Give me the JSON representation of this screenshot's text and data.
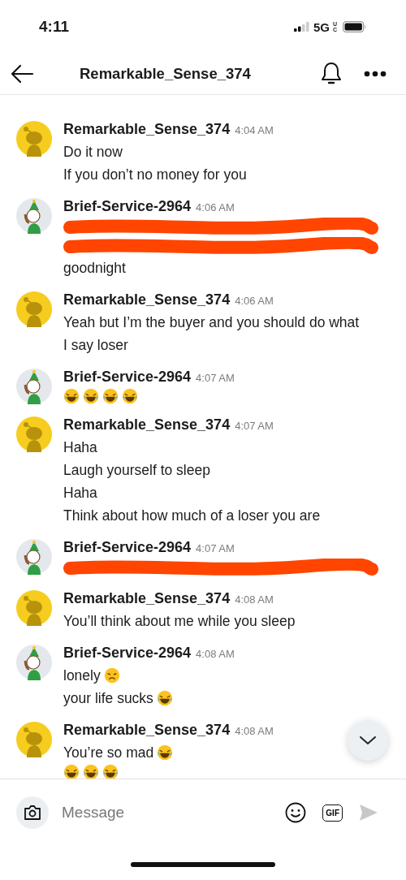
{
  "status_bar": {
    "time": "4:11",
    "network": "5G",
    "network_sub": "UC"
  },
  "header": {
    "title": "Remarkable_Sense_374"
  },
  "messages": [
    {
      "author": "Remarkable_Sense_374",
      "time": "4:04 AM",
      "avatar": {
        "kind": "yellow"
      },
      "lines": [
        {
          "kind": "text",
          "text": "Do it now"
        },
        {
          "kind": "text",
          "text": "If you don’t no money for you"
        }
      ]
    },
    {
      "author": "Brief-Service-2964",
      "time": "4:06 AM",
      "avatar": {
        "kind": "holiday"
      },
      "lines": [
        {
          "kind": "redacted"
        },
        {
          "kind": "redacted"
        },
        {
          "kind": "text",
          "text": "goodnight"
        }
      ]
    },
    {
      "author": "Remarkable_Sense_374",
      "time": "4:06 AM",
      "avatar": {
        "kind": "yellow"
      },
      "lines": [
        {
          "kind": "text",
          "text": "Yeah but I’m the buyer and you should do what I say loser"
        }
      ]
    },
    {
      "author": "Brief-Service-2964",
      "time": "4:07 AM",
      "avatar": {
        "kind": "holiday"
      },
      "lines": [
        {
          "kind": "text",
          "emoji": [
            {
              "kind": "laugh"
            },
            {
              "kind": "laugh"
            },
            {
              "kind": "laugh"
            },
            {
              "kind": "laugh"
            }
          ]
        }
      ]
    },
    {
      "author": "Remarkable_Sense_374",
      "time": "4:07 AM",
      "avatar": {
        "kind": "yellow"
      },
      "lines": [
        {
          "kind": "text",
          "text": "Haha"
        },
        {
          "kind": "text",
          "text": "Laugh yourself to sleep"
        },
        {
          "kind": "text",
          "text": "Haha"
        },
        {
          "kind": "text",
          "text": "Think about how much of a loser you are"
        }
      ]
    },
    {
      "author": "Brief-Service-2964",
      "time": "4:07 AM",
      "avatar": {
        "kind": "holiday"
      },
      "lines": [
        {
          "kind": "redacted"
        }
      ]
    },
    {
      "author": "Remarkable_Sense_374",
      "time": "4:08 AM",
      "avatar": {
        "kind": "yellow"
      },
      "lines": [
        {
          "kind": "text",
          "text": "You’ll think about me while you sleep"
        }
      ]
    },
    {
      "author": "Brief-Service-2964",
      "time": "4:08 AM",
      "avatar": {
        "kind": "holiday"
      },
      "lines": [
        {
          "kind": "text",
          "text": "lonely",
          "emoji": [
            {
              "kind": "sad"
            }
          ]
        },
        {
          "kind": "text",
          "text": "your life sucks",
          "emoji": [
            {
              "kind": "laugh"
            }
          ]
        }
      ]
    },
    {
      "author": "Remarkable_Sense_374",
      "time": "4:08 AM",
      "avatar": {
        "kind": "yellow"
      },
      "lines": [
        {
          "kind": "text",
          "text": "You’re so mad",
          "emoji": [
            {
              "kind": "laugh"
            }
          ]
        },
        {
          "kind": "text",
          "emoji": [
            {
              "kind": "laugh"
            },
            {
              "kind": "laugh"
            },
            {
              "kind": "laugh"
            }
          ]
        }
      ]
    }
  ],
  "composer": {
    "placeholder": "Message",
    "gif_label": "GIF"
  }
}
